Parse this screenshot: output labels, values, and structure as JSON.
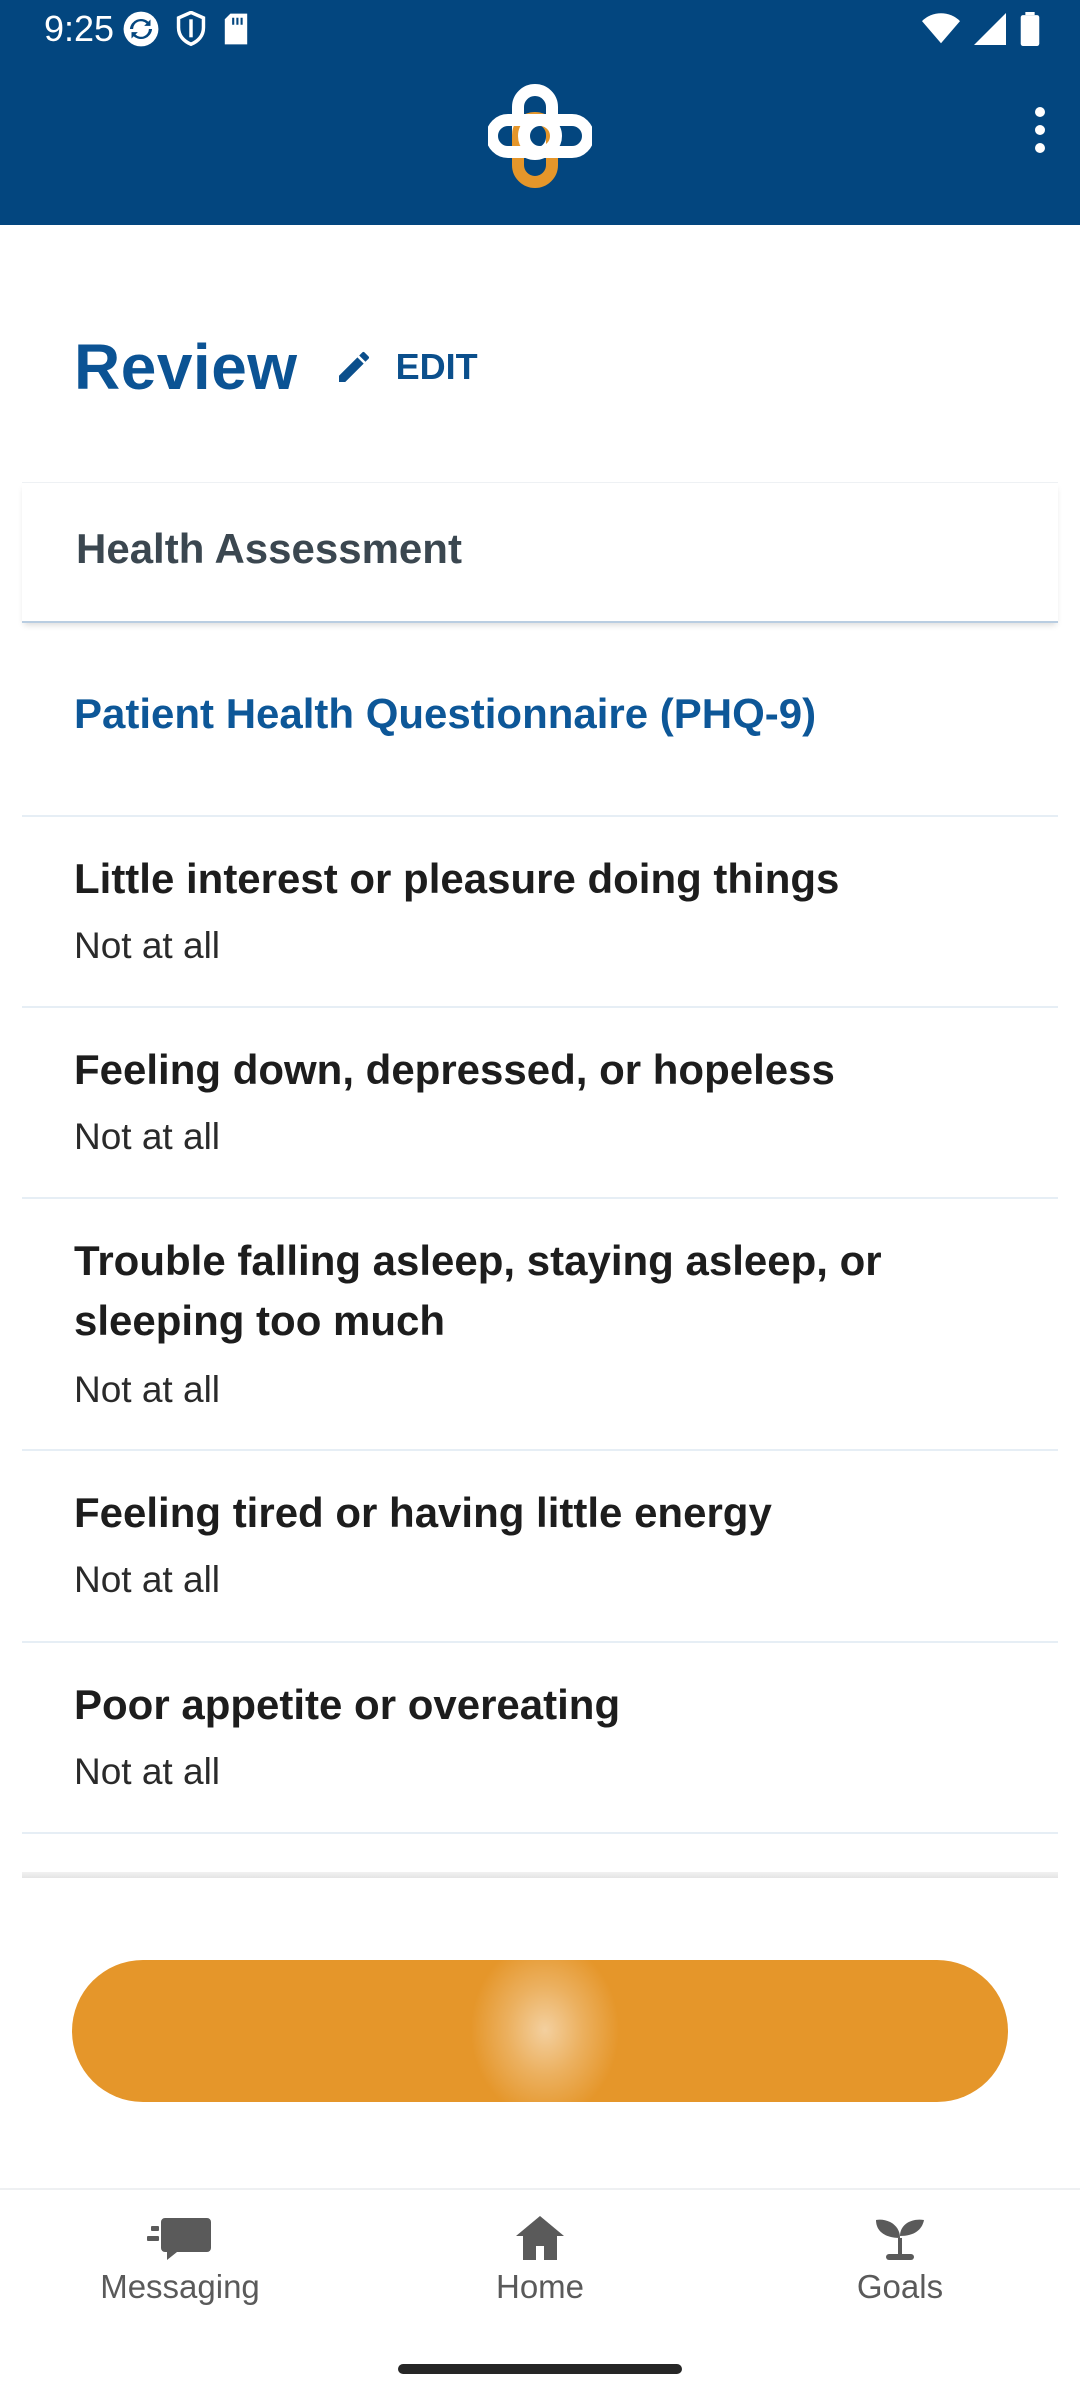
{
  "status_bar": {
    "time": "9:25"
  },
  "header": {
    "logo": "plus-cross-logo",
    "menu_icon": "more-vertical-icon"
  },
  "review": {
    "title": "Review",
    "edit_label": "EDIT"
  },
  "section": {
    "title": "Health Assessment"
  },
  "questionnaire": {
    "title": "Patient Health Questionnaire (PHQ-9)",
    "items": [
      {
        "question": "Little interest or pleasure doing things",
        "answer": "Not at all"
      },
      {
        "question": "Feeling down, depressed, or hopeless",
        "answer": "Not at all"
      },
      {
        "question": "Trouble falling asleep, staying asleep, or sleeping too much",
        "answer": "Not at all"
      },
      {
        "question": "Feeling tired or having little energy",
        "answer": "Not at all"
      },
      {
        "question": "Poor appetite or overeating",
        "answer": "Not at all"
      }
    ]
  },
  "bottom_nav": {
    "items": [
      {
        "label": "Messaging",
        "icon": "chat-icon"
      },
      {
        "label": "Home",
        "icon": "home-icon"
      },
      {
        "label": "Goals",
        "icon": "sprout-icon"
      }
    ]
  },
  "colors": {
    "brand": "#03467f",
    "accent": "#e5962a",
    "title": "#0b5394"
  }
}
